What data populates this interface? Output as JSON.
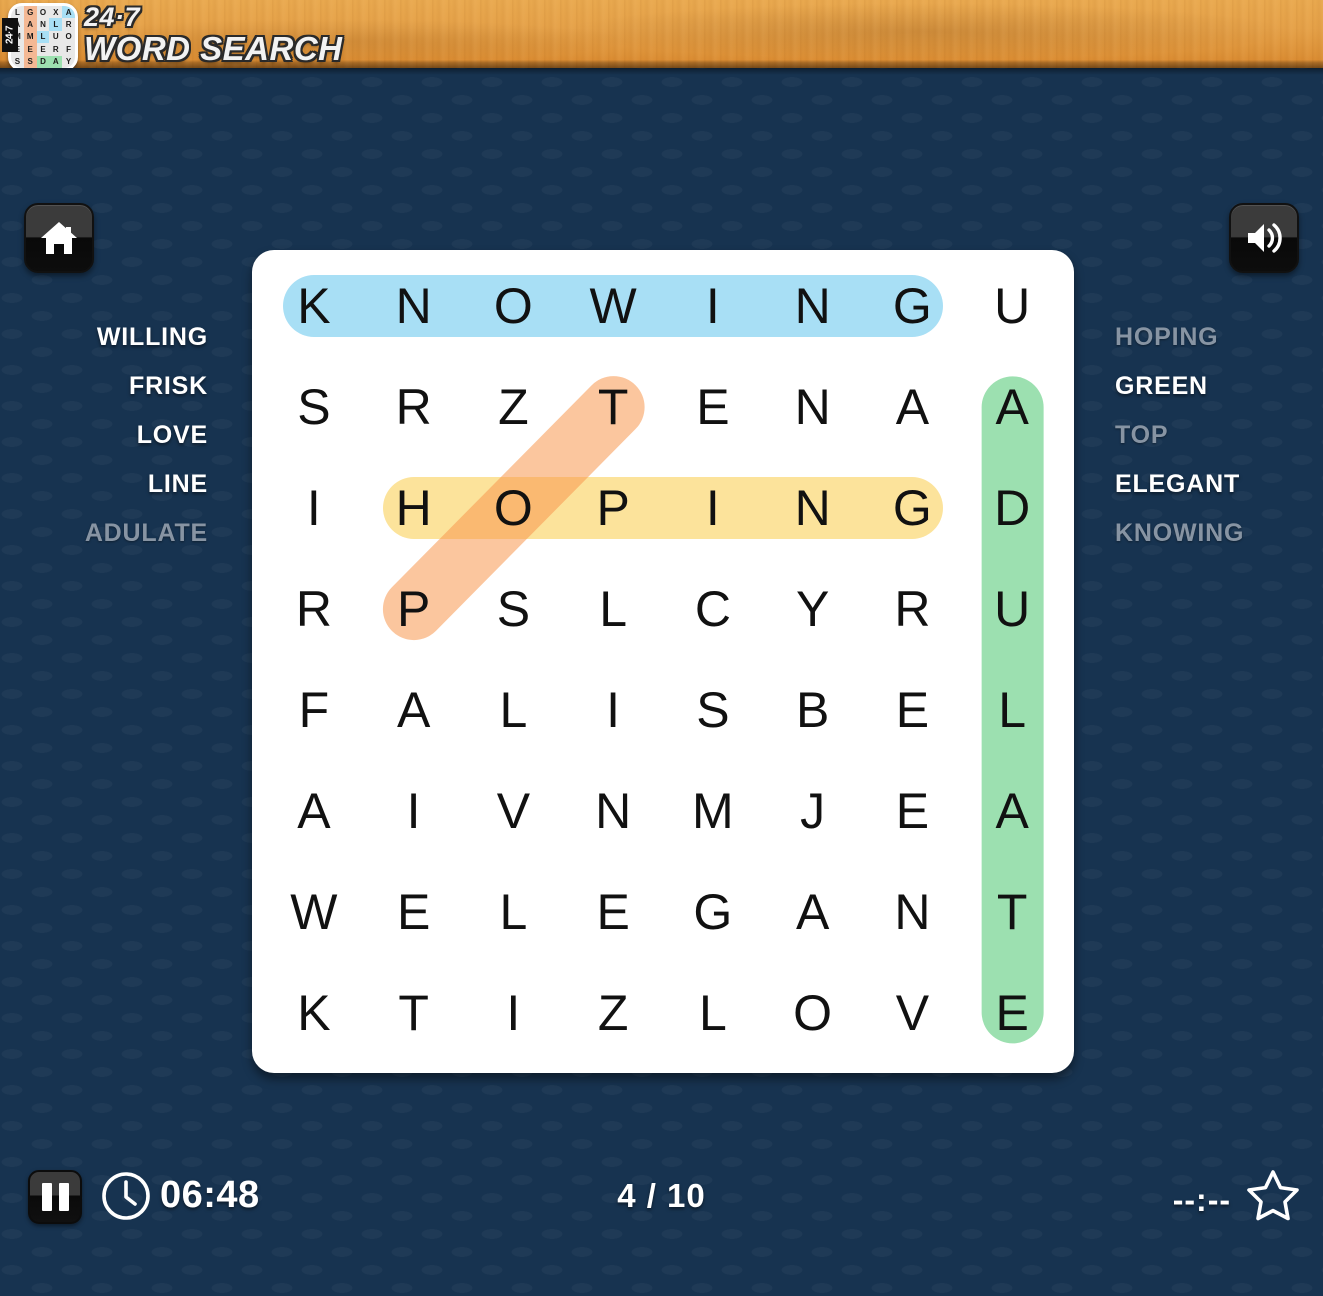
{
  "app": {
    "brand_line1": "24·7",
    "brand_line2": "WORD SEARCH",
    "logo_badge": "24·7",
    "logo_grid": [
      [
        "L",
        "G",
        "O",
        "X",
        "A"
      ],
      [
        "A",
        "A",
        "N",
        "L",
        "R"
      ],
      [
        "M",
        "M",
        "L",
        "U",
        "O"
      ],
      [
        "E",
        "E",
        "E",
        "R",
        "F"
      ],
      [
        "S",
        "S",
        "D",
        "A",
        "Y"
      ]
    ]
  },
  "colors": {
    "header_wood": "#e5a148",
    "background": "#173350",
    "board": "#ffffff",
    "highlight_blue": "#a8dff5",
    "highlight_yellow": "#fce39b",
    "highlight_green": "#9ce0b0",
    "highlight_orange": "#f8984e",
    "word_active": "#ffffff",
    "word_found": "#8794a3"
  },
  "buttons": {
    "home_label": "Home",
    "sound_label": "Sound",
    "pause_label": "Pause"
  },
  "word_list_left": [
    {
      "word": "WILLING",
      "found": false
    },
    {
      "word": "FRISK",
      "found": false
    },
    {
      "word": "LOVE",
      "found": false
    },
    {
      "word": "LINE",
      "found": false
    },
    {
      "word": "ADULATE",
      "found": true
    }
  ],
  "word_list_right": [
    {
      "word": "HOPING",
      "found": true
    },
    {
      "word": "GREEN",
      "found": false
    },
    {
      "word": "TOP",
      "found": true
    },
    {
      "word": "ELEGANT",
      "found": false
    },
    {
      "word": "KNOWING",
      "found": true
    }
  ],
  "grid": {
    "rows": 8,
    "cols": 8,
    "letters": [
      [
        "K",
        "N",
        "O",
        "W",
        "I",
        "N",
        "G",
        "U"
      ],
      [
        "S",
        "R",
        "Z",
        "T",
        "E",
        "N",
        "A",
        "A"
      ],
      [
        "I",
        "H",
        "O",
        "P",
        "I",
        "N",
        "G",
        "D"
      ],
      [
        "R",
        "P",
        "S",
        "L",
        "C",
        "Y",
        "R",
        "U"
      ],
      [
        "F",
        "A",
        "L",
        "I",
        "S",
        "B",
        "E",
        "L"
      ],
      [
        "A",
        "I",
        "V",
        "N",
        "M",
        "J",
        "E",
        "A"
      ],
      [
        "W",
        "E",
        "L",
        "E",
        "G",
        "A",
        "N",
        "T"
      ],
      [
        "K",
        "T",
        "I",
        "Z",
        "L",
        "O",
        "V",
        "E"
      ]
    ],
    "found_words": [
      {
        "word": "KNOWING",
        "color": "blue",
        "direction": "horizontal",
        "start": [
          0,
          0
        ],
        "end": [
          0,
          6
        ]
      },
      {
        "word": "HOPING",
        "color": "yellow",
        "direction": "horizontal",
        "start": [
          2,
          1
        ],
        "end": [
          2,
          6
        ]
      },
      {
        "word": "ADULATE",
        "color": "green",
        "direction": "vertical",
        "start": [
          1,
          7
        ],
        "end": [
          7,
          7
        ]
      },
      {
        "word": "TOP",
        "color": "orange",
        "direction": "diagonal-down-left",
        "start": [
          1,
          3
        ],
        "end": [
          3,
          1
        ]
      }
    ]
  },
  "status": {
    "timer": "06:48",
    "progress": "4 / 10",
    "best_time": "--:--"
  },
  "icons": {
    "home": "home-icon",
    "sound": "speaker-icon",
    "pause": "pause-icon",
    "clock": "clock-icon",
    "star": "star-icon"
  }
}
